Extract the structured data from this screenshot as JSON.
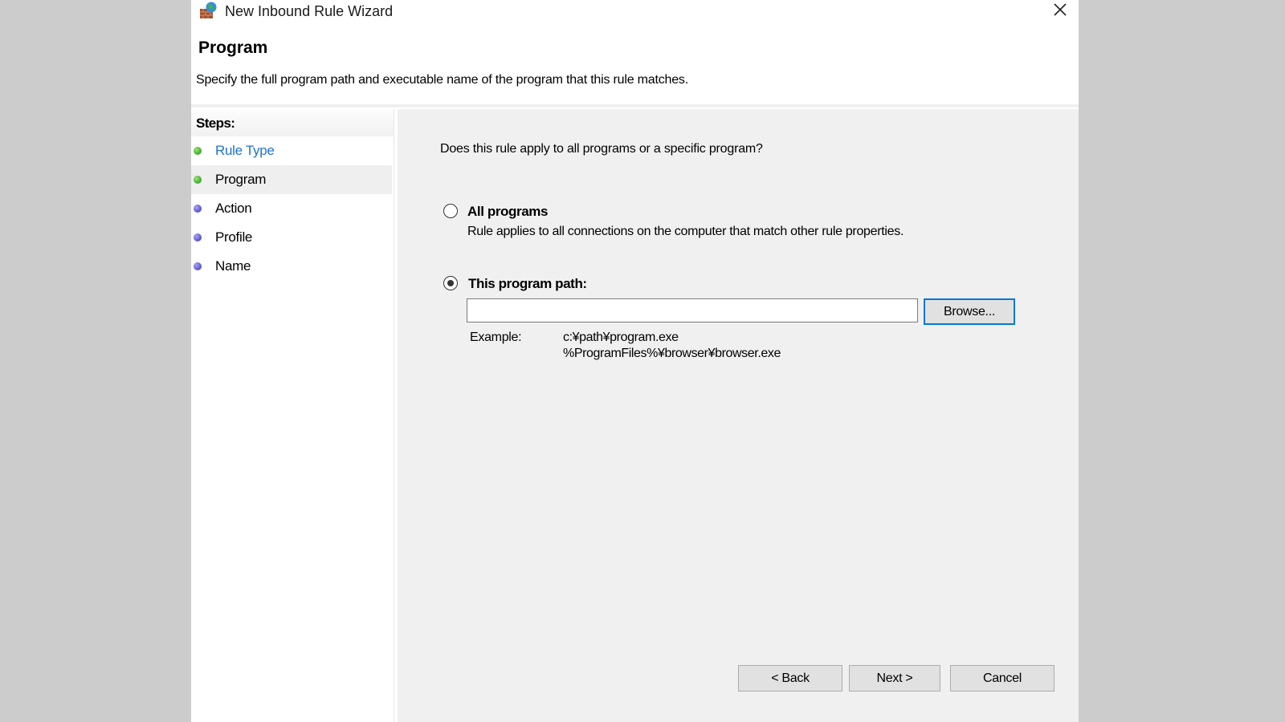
{
  "window": {
    "title": "New Inbound Rule Wizard",
    "app_icon": "firewall-globe-icon",
    "close_icon": "close-icon"
  },
  "header": {
    "title": "Program",
    "description": "Specify the full program path and executable name of the program that this rule matches."
  },
  "steps": {
    "heading": "Steps:",
    "items": [
      {
        "label": "Rule Type",
        "status": "done",
        "link": true,
        "current": false
      },
      {
        "label": "Program",
        "status": "done",
        "link": false,
        "current": true
      },
      {
        "label": "Action",
        "status": "todo",
        "link": false,
        "current": false
      },
      {
        "label": "Profile",
        "status": "todo",
        "link": false,
        "current": false
      },
      {
        "label": "Name",
        "status": "todo",
        "link": false,
        "current": false
      }
    ]
  },
  "content": {
    "question": "Does this rule apply to all programs or a specific program?",
    "options": [
      {
        "label": "All programs",
        "description": "Rule applies to all connections on the computer that match other rule properties.",
        "selected": false
      },
      {
        "label": "This program path:",
        "selected": true
      }
    ],
    "path_input": {
      "value": "",
      "placeholder": ""
    },
    "browse_label": "Browse...",
    "example_label": "Example:",
    "examples": [
      "c:¥path¥program.exe",
      "%ProgramFiles%¥browser¥browser.exe"
    ]
  },
  "footer": {
    "back_label": "< Back",
    "next_label": "Next >",
    "cancel_label": "Cancel"
  },
  "colors": {
    "link": "#1e73cf",
    "focus": "#0078d7",
    "step_done": "#3aa826",
    "step_todo": "#5450c8"
  }
}
